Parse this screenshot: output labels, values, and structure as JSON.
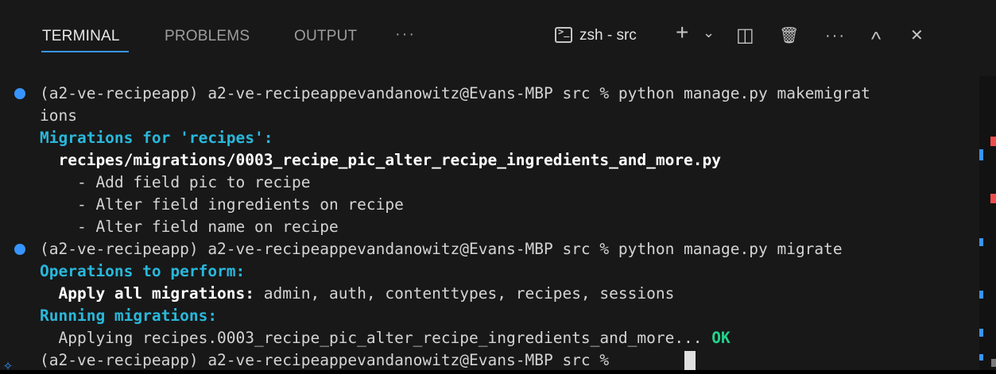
{
  "tabs": [
    {
      "label": "TERMINAL",
      "active": true
    },
    {
      "label": "PROBLEMS",
      "active": false
    },
    {
      "label": "OUTPUT",
      "active": false
    }
  ],
  "tab_more_label": "···",
  "toolbar": {
    "terminal_icon_glyph": ">_",
    "shell_label": "zsh - src",
    "add_glyph": "+",
    "add_dropdown_glyph": "⌄",
    "split_glyph": "◫",
    "trash_glyph": "🗑",
    "more_glyph": "···",
    "maximize_glyph": "^",
    "close_glyph": "✕"
  },
  "terminal": {
    "prompt": "(a2-ve-recipeapp) a2-ve-recipeappevandanowitz@Evans-MBP src %",
    "cmd1_part1": " python manage.py makemigrat",
    "cmd1_part2": "ions",
    "migrations_header": "Migrations for 'recipes':",
    "migration_file": "  recipes/migrations/0003_recipe_pic_alter_recipe_ingredients_and_more.py",
    "change1": "    - Add field pic to recipe",
    "change2": "    - Alter field ingredients on recipe",
    "change3": "    - Alter field name on recipe",
    "cmd2": " python manage.py migrate",
    "ops_header": "Operations to perform:",
    "apply_label": "  Apply all migrations:",
    "apply_apps": " admin, auth, contenttypes, recipes, sessions",
    "running_header": "Running migrations:",
    "applying_line": "  Applying recipes.0003_recipe_pic_alter_recipe_ingredients_and_more...",
    "ok_label": " OK",
    "final_prompt": "(a2-ve-recipeapp) a2-ve-recipeappevandanowitz@Evans-MBP src % "
  },
  "colors": {
    "accent": "#3794ff",
    "cyan": "#29b8db",
    "ok_green": "#23d18b",
    "error_red": "#f14c4c"
  }
}
